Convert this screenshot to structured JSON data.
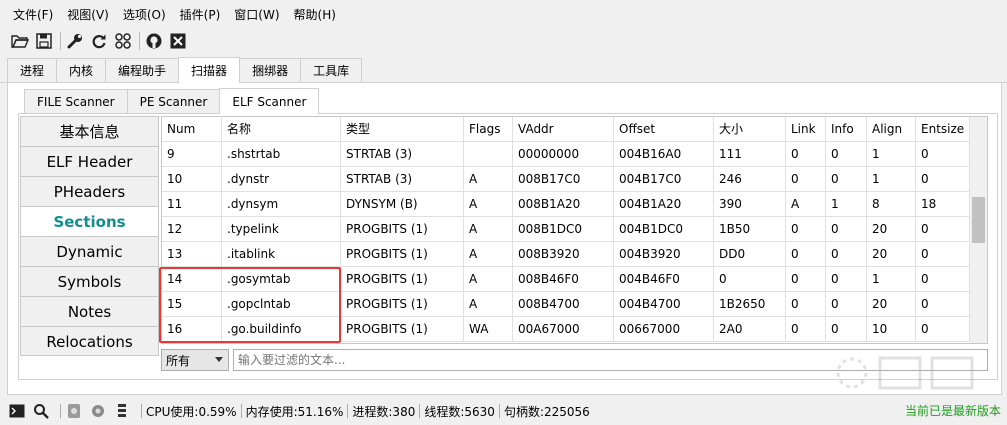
{
  "menubar": {
    "items": [
      "文件(F)",
      "视图(V)",
      "选项(O)",
      "插件(P)",
      "窗口(W)",
      "帮助(H)"
    ]
  },
  "toolbar": {
    "icons": [
      "folder-open-icon",
      "save-icon",
      "wrench-icon",
      "refresh-icon",
      "grid-icon",
      "github-icon",
      "close-box-icon"
    ]
  },
  "main_tabs": [
    "进程",
    "内核",
    "编程助手",
    "扫描器",
    "捆绑器",
    "工具库"
  ],
  "main_tab_active": "扫描器",
  "scanner_tabs": [
    "FILE Scanner",
    "PE Scanner",
    "ELF Scanner"
  ],
  "scanner_tab_active": "ELF Scanner",
  "sidenav": [
    "基本信息",
    "ELF Header",
    "PHeaders",
    "Sections",
    "Dynamic",
    "Symbols",
    "Notes",
    "Relocations"
  ],
  "sidenav_active": "Sections",
  "table": {
    "columns": [
      "Num",
      "名称",
      "类型",
      "Flags",
      "VAddr",
      "Offset",
      "大小",
      "Link",
      "Info",
      "Align",
      "Entsize"
    ],
    "rows": [
      [
        "9",
        ".shstrtab",
        "STRTAB (3)",
        "",
        "00000000",
        "004B16A0",
        "111",
        "0",
        "0",
        "1",
        "0"
      ],
      [
        "10",
        ".dynstr",
        "STRTAB (3)",
        "A",
        "008B17C0",
        "004B17C0",
        "246",
        "0",
        "0",
        "1",
        "0"
      ],
      [
        "11",
        ".dynsym",
        "DYNSYM (B)",
        "A",
        "008B1A20",
        "004B1A20",
        "390",
        "A",
        "1",
        "8",
        "18"
      ],
      [
        "12",
        ".typelink",
        "PROGBITS (1)",
        "A",
        "008B1DC0",
        "004B1DC0",
        "1B50",
        "0",
        "0",
        "20",
        "0"
      ],
      [
        "13",
        ".itablink",
        "PROGBITS (1)",
        "A",
        "008B3920",
        "004B3920",
        "DD0",
        "0",
        "0",
        "20",
        "0"
      ],
      [
        "14",
        ".gosymtab",
        "PROGBITS (1)",
        "A",
        "008B46F0",
        "004B46F0",
        "0",
        "0",
        "0",
        "1",
        "0"
      ],
      [
        "15",
        ".gopclntab",
        "PROGBITS (1)",
        "A",
        "008B4700",
        "004B4700",
        "1B2650",
        "0",
        "0",
        "20",
        "0"
      ],
      [
        "16",
        ".go.buildinfo",
        "PROGBITS (1)",
        "WA",
        "00A67000",
        "00667000",
        "2A0",
        "0",
        "0",
        "10",
        "0"
      ]
    ]
  },
  "filter": {
    "select_value": "所有",
    "placeholder": "输入要过滤的文本..."
  },
  "statusbar": {
    "cpu": "CPU使用:0.59%",
    "mem": "内存使用:51.16%",
    "procs": "进程数:380",
    "threads": "线程数:5630",
    "handles": "句柄数:225056",
    "version": "当前已是最新版本"
  },
  "colors": {
    "active_nav": "#138e8e",
    "highlight_box": "#e53935",
    "status_ok": "#1e9e1e"
  }
}
